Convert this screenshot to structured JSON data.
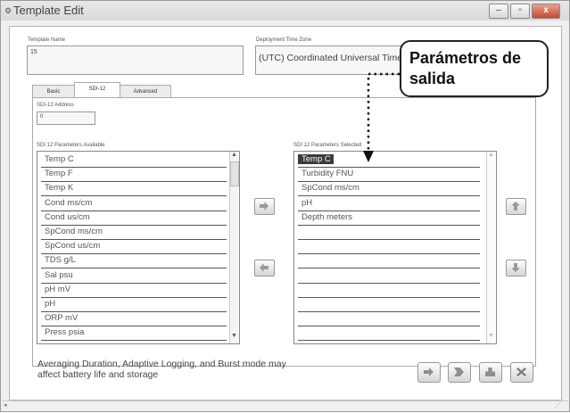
{
  "window": {
    "title": "Template Edit",
    "controls": [
      "–",
      "▫",
      "x"
    ]
  },
  "template_name": {
    "label": "Template Name",
    "value": "15"
  },
  "timezone": {
    "label": "Deployment Time Zone",
    "value": "(UTC) Coordinated Universal Time"
  },
  "tabs": [
    {
      "label": "Basic",
      "active": false
    },
    {
      "label": "SDI-12",
      "active": true
    },
    {
      "label": "Advanced",
      "active": false
    }
  ],
  "sdi_address": {
    "label": "SDI-12 Address",
    "value": "0"
  },
  "available": {
    "label": "SDI 12 Parameters Available",
    "items": [
      "Temp C",
      "Temp F",
      "Temp K",
      "Cond ms/cm",
      "Cond us/cm",
      "SpCond ms/cm",
      "SpCond us/cm",
      "TDS g/L",
      "Sal psu",
      "pH mV",
      "pH",
      "ORP mV",
      "Press psia"
    ]
  },
  "selected": {
    "label": "SDI 12 Parameters Selected",
    "items": [
      "Temp C",
      "Turbidity FNU",
      "SpCond ms/cm",
      "pH",
      "Depth meters",
      "",
      "",
      "",
      "",
      "",
      "",
      "",
      ""
    ],
    "highlighted_index": 0
  },
  "callout": {
    "text": "Parámetros de salida"
  },
  "note": "Averaging Duration, Adaptive Logging, and Burst mode may affect battery life and storage",
  "colors": {
    "selection": "#3a3a3a",
    "callout_border": "#222222"
  }
}
